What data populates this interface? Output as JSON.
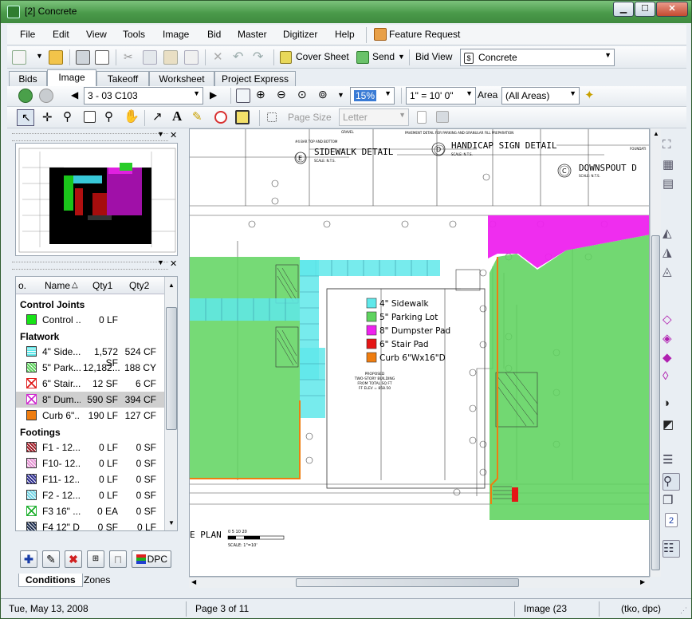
{
  "window": {
    "title": "[2] Concrete",
    "minimize": "▁",
    "maximize": "☐",
    "close": "✕"
  },
  "menu": [
    "File",
    "Edit",
    "View",
    "Tools",
    "Image",
    "Bid",
    "Master",
    "Digitizer",
    "Help"
  ],
  "menu_feature_request": "Feature Request",
  "toolbar1": {
    "cover_sheet": "Cover Sheet",
    "send": "Send",
    "bid_view_label": "Bid View",
    "bid_view_value": "Concrete"
  },
  "tabs": [
    "Bids",
    "Image",
    "Takeoff",
    "Worksheet",
    "Project Express"
  ],
  "active_tab": "Image",
  "toolbar2": {
    "page": "3 - 03 C103",
    "zoom": "15%",
    "scale": "1\" = 10' 0\"",
    "area_label": "Area",
    "area_value": "(All Areas)"
  },
  "toolbar3": {
    "page_size_label": "Page Size",
    "page_size_value": "Letter"
  },
  "conditions": {
    "headers": {
      "no": "o.",
      "name": "Name",
      "qty1": "Qty1",
      "qty2": "Qty2"
    },
    "groups": [
      {
        "name": "Control Joints",
        "rows": [
          {
            "name": "Control ...",
            "qty1": "0 LF",
            "qty2": "",
            "color": "#17e317",
            "pattern": "solid"
          }
        ]
      },
      {
        "name": "Flatwork",
        "rows": [
          {
            "name": "4\" Side...",
            "qty1": "1,572 SF",
            "qty2": "524 CF",
            "color": "#5fe8ea",
            "pattern": "cross"
          },
          {
            "name": "5\" Park...",
            "qty1": "12,182...",
            "qty2": "188 CY",
            "color": "#5ed35e",
            "pattern": "hatch"
          },
          {
            "name": "6\" Stair...",
            "qty1": "12 SF",
            "qty2": "6 CF",
            "color": "#e02020",
            "pattern": "x"
          },
          {
            "name": "8\" Dum...",
            "qty1": "590 SF",
            "qty2": "394 CF",
            "color": "#d02bd0",
            "pattern": "x",
            "selected": true
          },
          {
            "name": "Curb 6\"...",
            "qty1": "190 LF",
            "qty2": "127 CF",
            "color": "#ef7d10",
            "pattern": "solid"
          }
        ]
      },
      {
        "name": "Footings",
        "rows": [
          {
            "name": "F1 - 12...",
            "qty1": "0 LF",
            "qty2": "0 SF",
            "color": "#a0202a",
            "pattern": "hatch"
          },
          {
            "name": "F10- 12...",
            "qty1": "0 LF",
            "qty2": "0 SF",
            "color": "#e596d4",
            "pattern": "hatch"
          },
          {
            "name": "F11- 12...",
            "qty1": "0 LF",
            "qty2": "0 SF",
            "color": "#303090",
            "pattern": "hatch"
          },
          {
            "name": "F2 - 12...",
            "qty1": "0 LF",
            "qty2": "0 SF",
            "color": "#76d6e6",
            "pattern": "hatch"
          },
          {
            "name": "F3 16\" ...",
            "qty1": "0 EA",
            "qty2": "0 SF",
            "color": "#20b030",
            "pattern": "x"
          },
          {
            "name": "F4 12\" D",
            "qty1": "0 SF",
            "qty2": "0 LF",
            "color": "#203050",
            "pattern": "hatch"
          }
        ]
      }
    ]
  },
  "panel_buttons": {
    "dpc": "DPC"
  },
  "bottom_tabs": [
    "Conditions",
    "Zones"
  ],
  "drawing": {
    "legend": [
      {
        "label": "4\" Sidewalk",
        "color": "#5fe8ea"
      },
      {
        "label": "5\" Parking Lot",
        "color": "#5ed35e"
      },
      {
        "label": "8\" Dumpster Pad",
        "color": "#ee22ee"
      },
      {
        "label": "6\" Stair Pad",
        "color": "#e51616"
      },
      {
        "label": "Curb 6\"Wx16\"D",
        "color": "#ef7d10"
      }
    ],
    "labels": {
      "sidewalk_detail": "SIDEWALK DETAIL",
      "sidewalk_detail_mark": "E",
      "handicap_detail": "HANDICAP SIGN DETAIL",
      "handicap_detail_mark": "D",
      "downspout_detail": "DOWNSPOUT D",
      "downspout_detail_mark": "C",
      "gravel": "GRAVEL",
      "foundation": "FOUNDATI",
      "scale_nts_1": "SCALE: N.T.S.",
      "scale_nts_2": "SCALE: N.T.S.",
      "scale_nts_3": "SCALE: N.T.S.",
      "note_top_left": "#4 BAR TOP AND BOTTOM",
      "note_top_mid": "PAVEMENT DETAIL FOR PARKING AND GRANULAR FILL PREPARATION",
      "proposed_1": "PROPOSED",
      "proposed_2": "TWO-STORY BUILDING",
      "proposed_3": "FROM TOTAL SQ FT",
      "proposed_4": "FF ELEV = 858.50",
      "plan_title": "E PLAN",
      "plan_scale": "SCALE: 1\"=10'",
      "scale_bar_text": "0  5  10      20"
    }
  },
  "status": {
    "date": "Tue, May 13, 2008",
    "page": "Page 3 of 11",
    "image": "Image (23",
    "user": "(tko, dpc)"
  }
}
